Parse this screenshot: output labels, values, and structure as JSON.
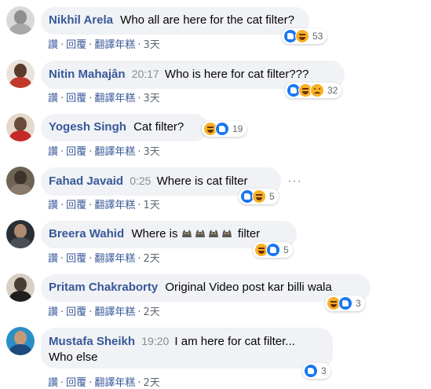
{
  "comments": [
    {
      "name": "Nikhil Arela",
      "time": "",
      "text": "Who all are here for the cat filter?",
      "actions": {
        "like": "讚",
        "reply": "回覆",
        "translate": "翻譯年糕",
        "age": "3天"
      },
      "reactions_count": "53",
      "reactions": [
        "like",
        "haha"
      ],
      "avatar_colors": [
        "#c9c9c9",
        "#8e8e8e"
      ]
    },
    {
      "name": "Nitin Mahajân",
      "time": "20:17",
      "text": "Who is here for cat filter???",
      "actions": {
        "like": "讚",
        "reply": "回覆",
        "translate": "翻譯年糕",
        "age": "3天"
      },
      "reactions_count": "32",
      "reactions": [
        "like",
        "haha",
        "sad"
      ],
      "avatar_colors": [
        "#5a3a2a",
        "#c0392b"
      ]
    },
    {
      "name": "Yogesh Singh",
      "time": "",
      "text": "Cat filter?",
      "actions": {
        "like": "讚",
        "reply": "回覆",
        "translate": "翻譯年糕",
        "age": "3天"
      },
      "reactions_count": "19",
      "reactions": [
        "haha",
        "like"
      ],
      "avatar_colors": [
        "#6a4a3a",
        "#c62828"
      ]
    },
    {
      "name": "Fahad Javaid",
      "time": "0:25",
      "text": "Where is cat filter",
      "actions": {
        "like": "讚",
        "reply": "回覆",
        "translate": "翻譯年糕",
        "age": "1天"
      },
      "reactions_count": "5",
      "reactions": [
        "like",
        "haha"
      ],
      "avatar_colors": [
        "#3e342c",
        "#7a6a5a"
      ]
    },
    {
      "name": "Breera Wahid",
      "time": "",
      "text_prefix": "Where is",
      "text_suffix": "filter",
      "cat_count": 4,
      "actions": {
        "like": "讚",
        "reply": "回覆",
        "translate": "翻譯年糕",
        "age": "2天"
      },
      "reactions_count": "5",
      "reactions": [
        "haha",
        "like"
      ],
      "avatar_colors": [
        "#2a2f35",
        "#4a4f55"
      ]
    },
    {
      "name": "Pritam Chakraborty",
      "time": "",
      "text": "Original Video post kar billi wala",
      "actions": {
        "like": "讚",
        "reply": "回覆",
        "translate": "翻譯年糕",
        "age": "2天"
      },
      "reactions_count": "3",
      "reactions": [
        "haha",
        "like"
      ],
      "avatar_colors": [
        "#4a3e33",
        "#1f1f1f"
      ]
    },
    {
      "name": "Mustafa Sheikh",
      "time": "19:20",
      "text": "I am here for cat filter...",
      "text_line2": "Who else",
      "actions": {
        "like": "讚",
        "reply": "回覆",
        "translate": "翻譯年糕",
        "age": "2天"
      },
      "reactions_count": "3",
      "reactions": [
        "like"
      ],
      "avatar_colors": [
        "#2b8fc7",
        "#1c4a7a"
      ]
    }
  ],
  "more_icon": "more-horizontal-icon",
  "colors": {
    "name": "#385898",
    "bubble": "#f0f2f5",
    "like": "#1877f2",
    "haha": "#f7b125"
  }
}
